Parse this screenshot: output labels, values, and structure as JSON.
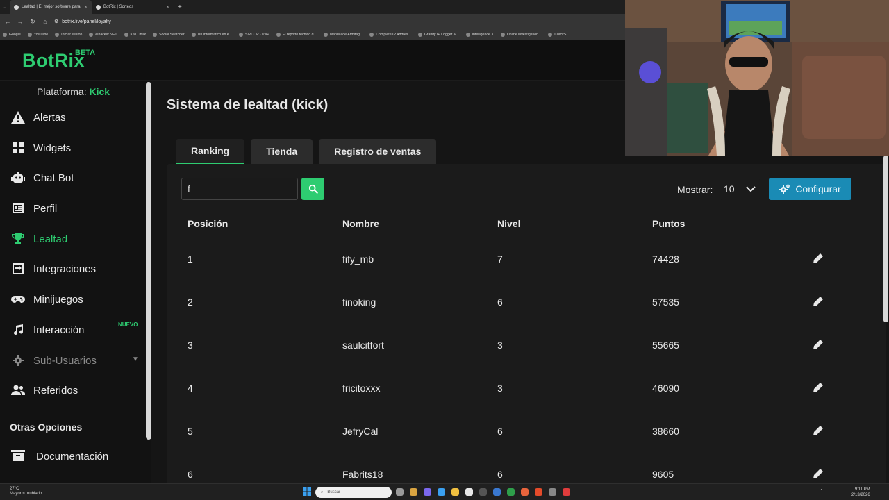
{
  "browser": {
    "tabs": [
      {
        "label": "Lealtad | El mejor software para",
        "active": true
      },
      {
        "label": "BotRix | Sorteos",
        "active": false
      }
    ],
    "new_tab": "+",
    "url": "botrix.live/panel/loyalty",
    "bookmarks": [
      "Google",
      "YouTube",
      "Iniciar sesión",
      "elhacker.NET",
      "Kali Linux",
      "Social Searcher",
      "Un informático en e...",
      "SIPCOP - PNP",
      "El reporte técnico d...",
      "Manual de Armitag...",
      "Complete IP Addres...",
      "Grabify IP Logger &...",
      "Intelligence X",
      "Online investigation...",
      "CrackS"
    ]
  },
  "app": {
    "logo": "BotRix",
    "beta": "BETA"
  },
  "sidebar": {
    "platform_label": "Plataforma:",
    "platform_value": "Kick",
    "items": [
      {
        "label": "Alertas",
        "icon": "alert-icon"
      },
      {
        "label": "Widgets",
        "icon": "grid-icon"
      },
      {
        "label": "Chat Bot",
        "icon": "robot-icon"
      },
      {
        "label": "Perfil",
        "icon": "profile-card-icon"
      },
      {
        "label": "Lealtad",
        "icon": "trophy-icon"
      },
      {
        "label": "Integraciones",
        "icon": "integrations-icon"
      },
      {
        "label": "Minijuegos",
        "icon": "gamepad-icon"
      },
      {
        "label": "Interacción",
        "icon": "music-icon"
      },
      {
        "label": "Sub-Usuarios",
        "icon": "cog-icon"
      },
      {
        "label": "Referidos",
        "icon": "users-icon"
      }
    ],
    "new_badge": "NUEVO",
    "section_title": "Otras Opciones",
    "docs_label": "Documentación"
  },
  "main": {
    "title": "Sistema de lealtad (kick)",
    "tabs": [
      "Ranking",
      "Tienda",
      "Registro de ventas"
    ],
    "search_value": "f",
    "show_label": "Mostrar:",
    "show_value": "10",
    "config_label": "Configurar",
    "columns": [
      "Posición",
      "Nombre",
      "Nivel",
      "Puntos"
    ],
    "rows": [
      {
        "pos": "1",
        "name": "fify_mb",
        "level": "7",
        "points": "74428"
      },
      {
        "pos": "2",
        "name": "finoking",
        "level": "6",
        "points": "57535"
      },
      {
        "pos": "3",
        "name": "saulcitfort",
        "level": "3",
        "points": "55665"
      },
      {
        "pos": "4",
        "name": "fricitoxxx",
        "level": "3",
        "points": "46090"
      },
      {
        "pos": "5",
        "name": "JefryCal",
        "level": "6",
        "points": "38660"
      },
      {
        "pos": "6",
        "name": "Fabrits18",
        "level": "6",
        "points": "9605"
      }
    ]
  },
  "taskbar": {
    "temp": "27°C",
    "weather": "Mayorm. nublado",
    "search_placeholder": "Buscar",
    "time": "9:11 PM",
    "date": "2/13/2026"
  },
  "colors": {
    "accent_green": "#2ecc71",
    "config_blue": "#1a8bb5"
  }
}
